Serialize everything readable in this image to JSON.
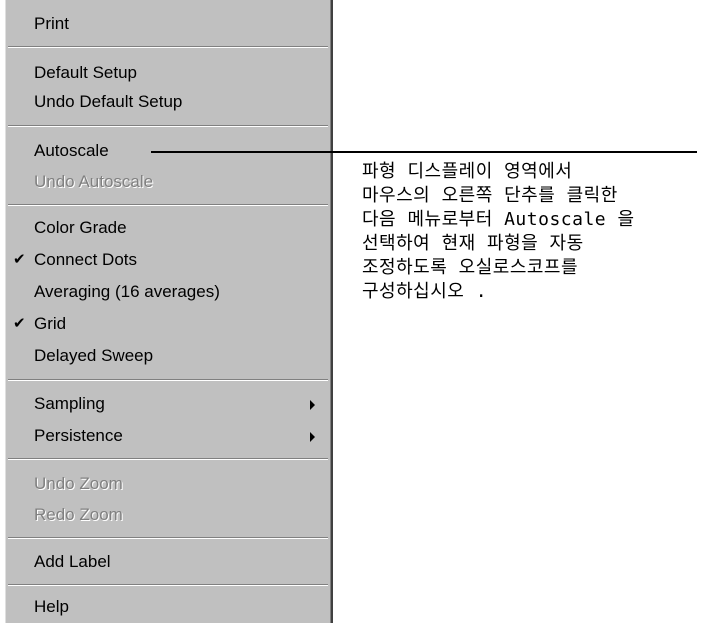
{
  "menu": {
    "items": [
      {
        "id": "print",
        "label": "Print",
        "disabled": false,
        "checked": false,
        "submenu": false
      },
      {
        "id": "default-setup",
        "label": "Default Setup",
        "disabled": false,
        "checked": false,
        "submenu": false
      },
      {
        "id": "undo-default-setup",
        "label": "Undo Default Setup",
        "disabled": false,
        "checked": false,
        "submenu": false
      },
      {
        "id": "autoscale",
        "label": "Autoscale",
        "disabled": false,
        "checked": false,
        "submenu": false
      },
      {
        "id": "undo-autoscale",
        "label": "Undo Autoscale",
        "disabled": true,
        "checked": false,
        "submenu": false
      },
      {
        "id": "color-grade",
        "label": "Color Grade",
        "disabled": false,
        "checked": false,
        "submenu": false
      },
      {
        "id": "connect-dots",
        "label": "Connect Dots",
        "disabled": false,
        "checked": true,
        "submenu": false
      },
      {
        "id": "averaging",
        "label": "Averaging (16 averages)",
        "disabled": false,
        "checked": false,
        "submenu": false
      },
      {
        "id": "grid",
        "label": "Grid",
        "disabled": false,
        "checked": true,
        "submenu": false
      },
      {
        "id": "delayed-sweep",
        "label": "Delayed Sweep",
        "disabled": false,
        "checked": false,
        "submenu": false
      },
      {
        "id": "sampling",
        "label": "Sampling",
        "disabled": false,
        "checked": false,
        "submenu": true
      },
      {
        "id": "persistence",
        "label": "Persistence",
        "disabled": false,
        "checked": false,
        "submenu": true
      },
      {
        "id": "undo-zoom",
        "label": "Undo Zoom",
        "disabled": true,
        "checked": false,
        "submenu": false
      },
      {
        "id": "redo-zoom",
        "label": "Redo Zoom",
        "disabled": true,
        "checked": false,
        "submenu": false
      },
      {
        "id": "add-label",
        "label": "Add Label",
        "disabled": false,
        "checked": false,
        "submenu": false
      },
      {
        "id": "help",
        "label": "Help",
        "disabled": false,
        "checked": false,
        "submenu": false
      }
    ],
    "check_glyph": "✔"
  },
  "callout": {
    "lines": [
      "파형 디스플레이 영역에서",
      "마우스의 오른쪽 단추를 클릭한",
      "다음 메뉴로부터 Autoscale 을",
      "선택하여 현재 파형을 자동",
      "조정하도록 오실로스코프를",
      "구성하십시오 ."
    ]
  }
}
